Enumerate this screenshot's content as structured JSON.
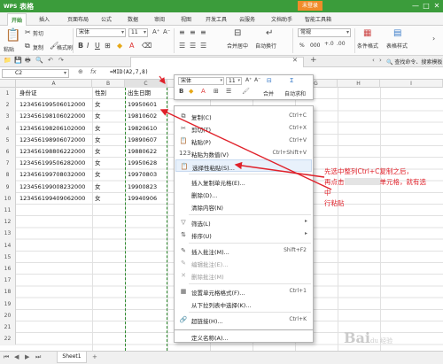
{
  "app": {
    "logo": "WPS",
    "title": "表格",
    "login_label": "未登录"
  },
  "window": {
    "min": "—",
    "max": "□",
    "close": "✕"
  },
  "menu": {
    "tabs": [
      "开始",
      "插入",
      "页面布局",
      "公式",
      "数据",
      "审阅",
      "视图",
      "开发工具",
      "云服务",
      "文档助手",
      "智能工具箱"
    ]
  },
  "ribbon": {
    "paste": "粘贴",
    "cut": "剪切",
    "copy": "复制",
    "format_painter": "格式刷",
    "font_name": "宋体",
    "font_size": "11",
    "merge_center": "合并居中",
    "wrap": "自动换行",
    "number_format": "常规",
    "percent": "%",
    "thousand": "000",
    "conditional_format": "条件格式",
    "table_style": "表格样式"
  },
  "quickbar": {
    "search": "查找命令、搜索模板"
  },
  "formula_bar": {
    "name_box": "C2",
    "fx": "fx",
    "formula": "=MID(A2,7,8)"
  },
  "columns": [
    "A",
    "B",
    "C",
    "D",
    "E",
    "F",
    "G",
    "H",
    "I"
  ],
  "rows": [
    "1",
    "2",
    "3",
    "4",
    "5",
    "6",
    "7",
    "8",
    "9",
    "10",
    "11",
    "12",
    "13",
    "14",
    "15",
    "16",
    "17",
    "18",
    "19",
    "20",
    "21",
    "22"
  ],
  "sheet": {
    "headers": [
      "身份证",
      "性别",
      "出生日期"
    ],
    "data": [
      [
        "123456199506012000",
        "女",
        "19950601"
      ],
      [
        "123456198106022000",
        "女",
        "19810602"
      ],
      [
        "123456198206102000",
        "女",
        "19820610"
      ],
      [
        "123456198906072000",
        "女",
        "19890607"
      ],
      [
        "123456198806222000",
        "女",
        "19880622"
      ],
      [
        "123456199506282000",
        "女",
        "19950628"
      ],
      [
        "123456199708032000",
        "女",
        "19970803"
      ],
      [
        "123456199008232000",
        "女",
        "19900823"
      ],
      [
        "123456199409062000",
        "女",
        "19940906"
      ]
    ]
  },
  "mini_toolbar": {
    "font": "宋体",
    "size": "11",
    "bold": "B",
    "merge": "合并",
    "autosum": "自动求和"
  },
  "context_menu": {
    "items": [
      {
        "label": "复制(C)",
        "shortcut": "Ctrl+C"
      },
      {
        "label": "剪切(T)",
        "shortcut": "Ctrl+X"
      },
      {
        "label": "粘贴(P)",
        "shortcut": "Ctrl+V"
      },
      {
        "label": "粘贴为数值(V)",
        "shortcut": "Ctrl+Shift+V"
      },
      {
        "label": "选择性粘贴(S)...",
        "shortcut": ""
      },
      {
        "label": "插入复制单元格(E)...",
        "shortcut": ""
      },
      {
        "label": "删除(D)...",
        "shortcut": ""
      },
      {
        "label": "清除内容(N)",
        "shortcut": ""
      },
      {
        "label": "筛选(L)",
        "shortcut": ""
      },
      {
        "label": "排序(U)",
        "shortcut": ""
      },
      {
        "label": "插入批注(M)...",
        "shortcut": "Shift+F2"
      },
      {
        "label": "编辑批注(E)...",
        "shortcut": ""
      },
      {
        "label": "删除批注(M)",
        "shortcut": ""
      },
      {
        "label": "设置单元格格式(F)...",
        "shortcut": "Ctrl+1"
      },
      {
        "label": "从下拉列表中选择(K)...",
        "shortcut": ""
      },
      {
        "label": "超链接(H)...",
        "shortcut": "Ctrl+K"
      },
      {
        "label": "定义名称(A)...",
        "shortcut": ""
      }
    ]
  },
  "annotation": {
    "line1": "先选中整列Ctrl+C复制之后，",
    "line2a": "再点击",
    "line2b": "单元格，就有选中",
    "line3": "行粘贴",
    "color": "#e0212a"
  },
  "status": {
    "sheet_tab": "Sheet1"
  },
  "colors": {
    "brand": "#3b9c3b",
    "selection": "#2e8b2e",
    "highlight": "#e8f1fb"
  },
  "watermark": {
    "main": "Bai",
    "sub": "du 经验"
  }
}
